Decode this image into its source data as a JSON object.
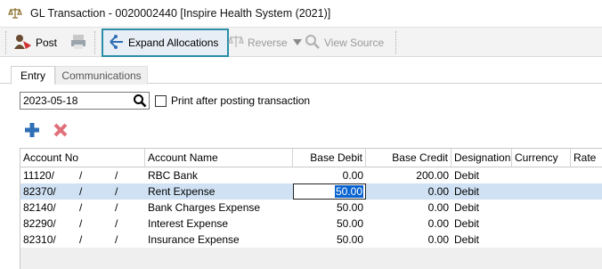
{
  "window": {
    "title": "GL Transaction - 0020002440 [Inspire Health System (2021)]"
  },
  "toolbar": {
    "post_label": "Post",
    "expand_label": "Expand Allocations",
    "reverse_label": "Reverse",
    "view_source_label": "View Source"
  },
  "tabs": [
    {
      "label": "Entry"
    },
    {
      "label": "Communications"
    }
  ],
  "form": {
    "date_value": "2023-05-18",
    "print_label": "Print after posting transaction"
  },
  "grid": {
    "headers": {
      "account_no": "Account No",
      "account_name": "Account Name",
      "base_debit": "Base Debit",
      "base_credit": "Base Credit",
      "designation": "Designation",
      "currency": "Currency",
      "rate": "Rate"
    },
    "rows": [
      {
        "account": "11120/",
        "seg2": "/",
        "seg3": "/",
        "name": "RBC Bank",
        "debit": "0.00",
        "credit": "200.00",
        "designation": "Debit"
      },
      {
        "account": "82370/",
        "seg2": "/",
        "seg3": "/",
        "name": "Rent Expense",
        "debit": "50.00",
        "credit": "0.00",
        "designation": "Debit"
      },
      {
        "account": "82140/",
        "seg2": "/",
        "seg3": "/",
        "name": "Bank Charges Expense",
        "debit": "50.00",
        "credit": "0.00",
        "designation": "Debit"
      },
      {
        "account": "82290/",
        "seg2": "/",
        "seg3": "/",
        "name": "Interest Expense",
        "debit": "50.00",
        "credit": "0.00",
        "designation": "Debit"
      },
      {
        "account": "82310/",
        "seg2": "/",
        "seg3": "/",
        "name": "Insurance Expense",
        "debit": "50.00",
        "credit": "0.00",
        "designation": "Debit"
      }
    ]
  },
  "colors": {
    "highlight_border": "#2a8fa8",
    "selected_row": "#cfe1f3",
    "add_icon": "#2f6fb5",
    "delete_icon": "#e0707a"
  },
  "icons": [
    "scales-icon",
    "post-icon",
    "print-icon",
    "expand-allocations-icon",
    "reverse-icon",
    "view-source-icon",
    "search-icon",
    "add-icon",
    "delete-icon"
  ]
}
